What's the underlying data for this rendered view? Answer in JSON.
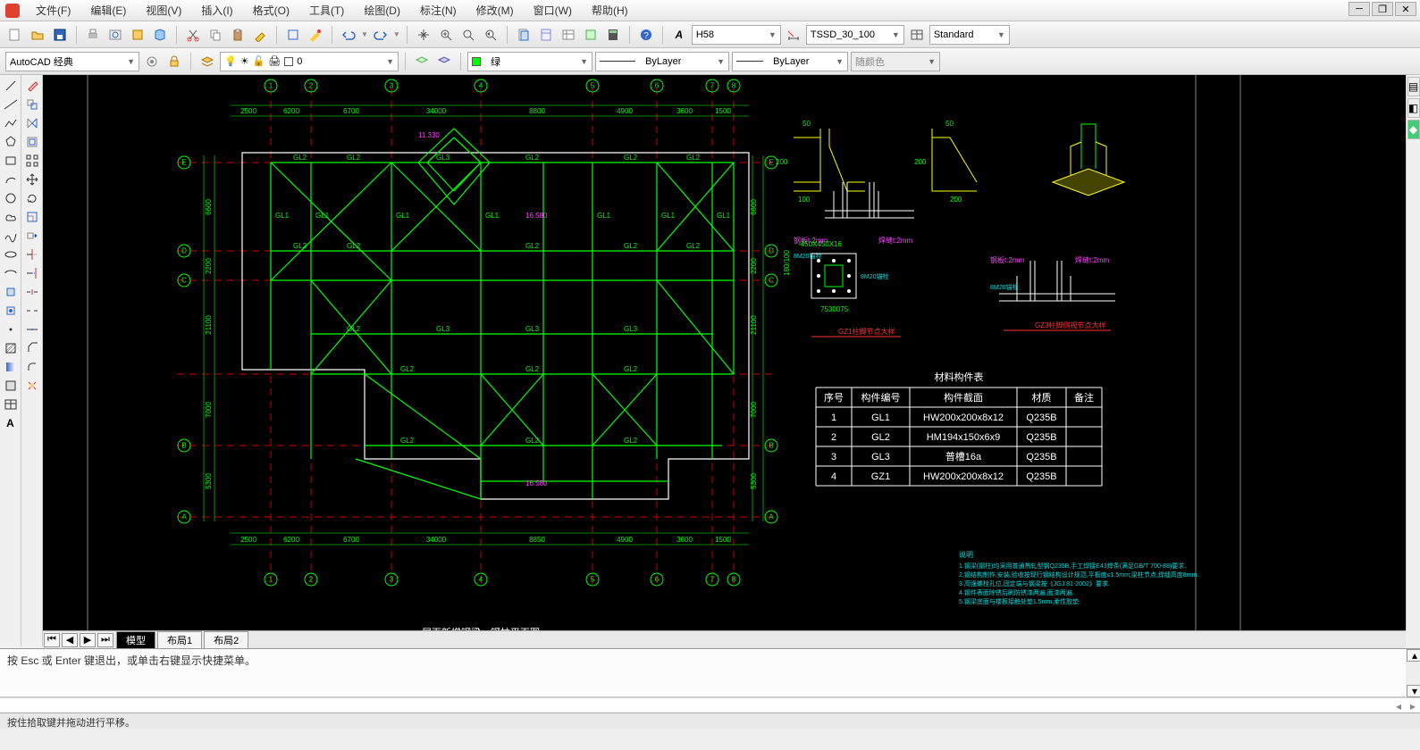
{
  "menu": {
    "file": "文件(F)",
    "edit": "编辑(E)",
    "view": "视图(V)",
    "insert": "插入(I)",
    "format": "格式(O)",
    "tools": "工具(T)",
    "draw": "绘图(D)",
    "annotate": "标注(N)",
    "modify": "修改(M)",
    "window": "窗口(W)",
    "help": "帮助(H)"
  },
  "row1": {
    "textstyle": "H58",
    "dimstyle": "TSSD_30_100",
    "tablestyle": "Standard"
  },
  "row2": {
    "workspace": "AutoCAD 经典",
    "layer": "0",
    "color": "绿",
    "ltype": "ByLayer",
    "lweight": "ByLayer",
    "plotstyle": "随颜色"
  },
  "tabs": {
    "model": "模型",
    "layout1": "布局1",
    "layout2": "布局2"
  },
  "cmd": {
    "log1": "",
    "log2": "按 Esc 或 Enter 键退出，或单击右键显示快捷菜单。",
    "prompt": ""
  },
  "status": "按住拾取键并拖动进行平移。",
  "drawing": {
    "title": "屋面新增钢梁、钢柱平面图",
    "topDims": [
      "2500",
      "6200",
      "6700",
      "34000",
      "8800",
      "4900",
      "3600",
      "1500"
    ],
    "botDims": [
      "2500",
      "6200",
      "6700",
      "34000",
      "8850",
      "4900",
      "3600",
      "1500"
    ],
    "leftDims": [
      "6600",
      "2200",
      "21100",
      "7000",
      "5300"
    ],
    "rightDims": [
      "6600",
      "2200",
      "21100",
      "7000",
      "5300"
    ],
    "gridH": [
      "E",
      "D",
      "C",
      "B",
      "A"
    ],
    "gridV": [
      "1",
      "2",
      "3",
      "4",
      "5",
      "6",
      "7",
      "8"
    ],
    "beam": {
      "gl1": "GL1",
      "gl2": "GL2",
      "gl3": "GL3",
      "gz1": "GZ1",
      "d1": "11.330",
      "d2": "16.580"
    },
    "detail1": {
      "title": "GZ1柱脚节点大样",
      "s50": "50",
      "s200": "200",
      "s100": "100",
      "plate": "钢板t:2mm",
      "weld": "焊缝t:2mm",
      "anchor": "8M20锚栓"
    },
    "detail2": {
      "title": "GZ3柱脚侧视节点大样",
      "plate": "-450X450X16",
      "anchor": "8M20锚栓",
      "s753075": "7530075",
      "h100": "180/100",
      "s20": "20",
      "s200": "200",
      "plate2": "钢板t:2mm",
      "weld2": "焊缝t:2mm"
    },
    "table": {
      "title": "材料构件表",
      "hdr": {
        "no": "序号",
        "code": "构件编号",
        "section": "构件截面",
        "mat": "材质",
        "note": "备注"
      },
      "rows": [
        {
          "no": "1",
          "code": "GL1",
          "sec": "HW200x200x8x12",
          "mat": "Q235B",
          "note": ""
        },
        {
          "no": "2",
          "code": "GL2",
          "sec": "HM194x150x6x9",
          "mat": "Q235B",
          "note": ""
        },
        {
          "no": "3",
          "code": "GL3",
          "sec": "普槽16a",
          "mat": "Q235B",
          "note": ""
        },
        {
          "no": "4",
          "code": "GZ1",
          "sec": "HW200x200x8x12",
          "mat": "Q235B",
          "note": ""
        }
      ]
    },
    "notes": {
      "hdr": "说明",
      "n1": "1.钢梁(钢柱)均采用普通热轧型钢Q235B,手工焊接E43焊条(满足GB/T 700-88)要求.",
      "n2": "2.钢结构制作,安装,验收按现行钢结构设计规范,平板度≤1.5mm;梁柱节点,焊缝高度8mm.",
      "n3": "3.高强螺栓孔位,固定端与钢梁按《JGJ 81-2002》要求.",
      "n4": "4.钢件表面除锈后刷防锈漆两遍,面漆两遍.",
      "n5": "5.钢梁底面与楼板接触处垫1.5mm,柔性胶垫."
    }
  }
}
